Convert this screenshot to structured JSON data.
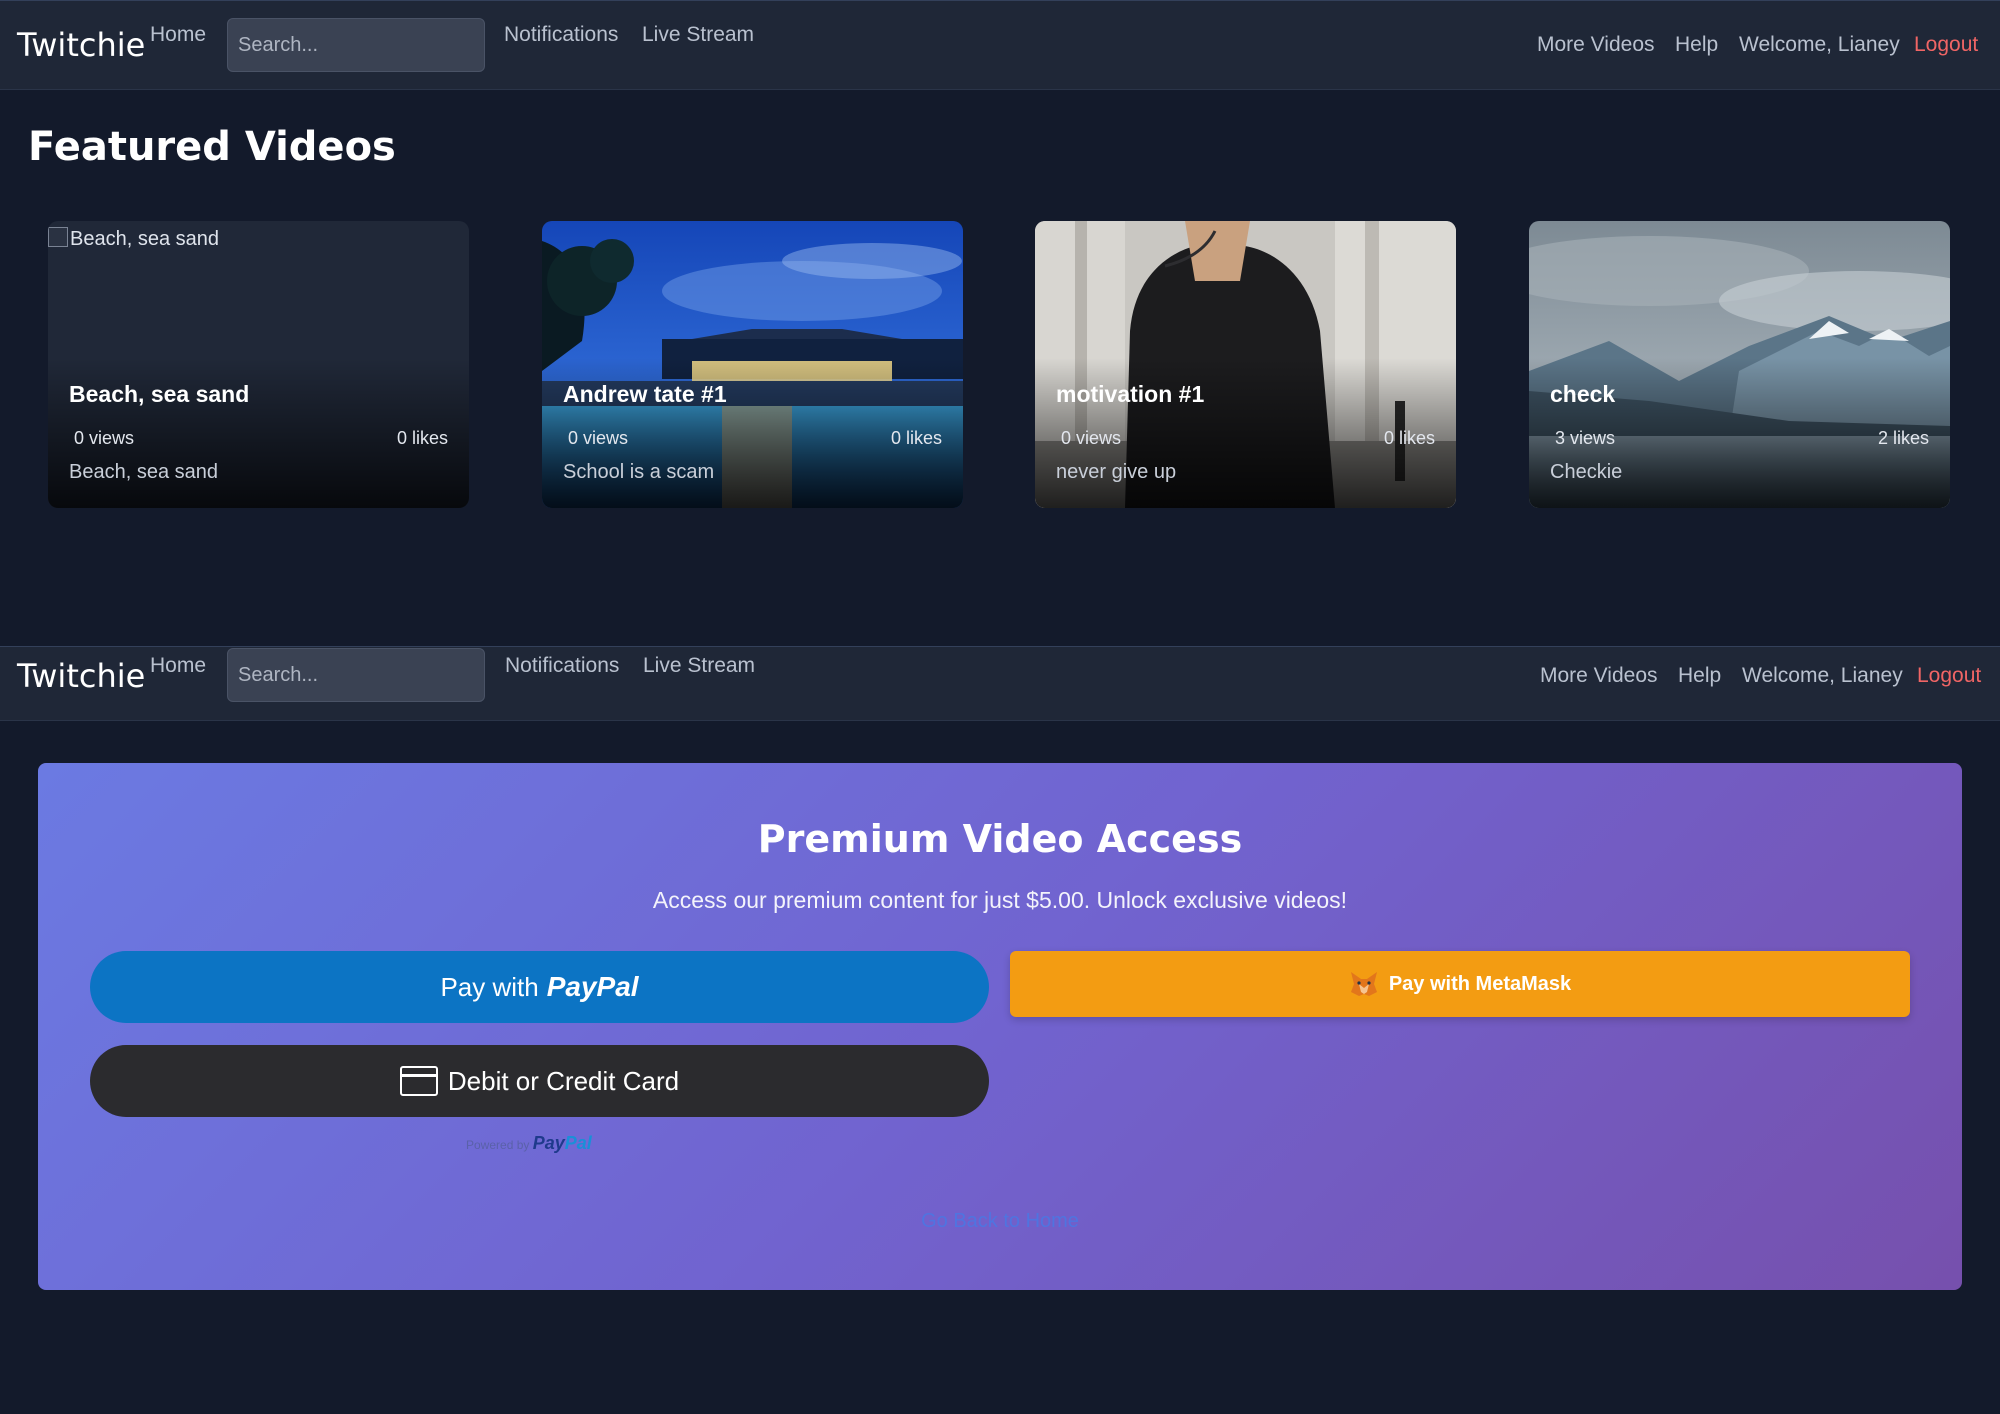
{
  "nav": {
    "brand": "Twitchie",
    "home": "Home",
    "search_placeholder": "Search...",
    "notifications": "Notifications",
    "live_stream": "Live Stream",
    "more_videos": "More Videos",
    "help": "Help",
    "welcome": "Welcome, Lianey",
    "logout": "Logout"
  },
  "featured": {
    "title": "Featured Videos",
    "cards": [
      {
        "alt": "Beach, sea sand",
        "title": "Beach, sea sand",
        "views": "0 views",
        "likes": "0 likes",
        "desc": "Beach, sea sand"
      },
      {
        "title": "Andrew tate #1",
        "views": "0 views",
        "likes": "0 likes",
        "desc": "School is a scam"
      },
      {
        "title": "motivation #1",
        "views": "0 views",
        "likes": "0 likes",
        "desc": "never give up"
      },
      {
        "title": "check",
        "views": "3 views",
        "likes": "2 likes",
        "desc": "Checkie"
      }
    ]
  },
  "premium": {
    "title": "Premium Video Access",
    "subtitle": "Access our premium content for just $5.00. Unlock exclusive videos!",
    "paypal_prefix": "Pay with",
    "paypal_brand": "PayPal",
    "card_label": "Debit or Credit Card",
    "metamask_label": "Pay with MetaMask",
    "powered_by": "Powered by",
    "powered_pay": "Pay",
    "powered_pal": "Pal",
    "back_link": "Go Back to Home"
  },
  "colors": {
    "background": "#131a2b",
    "navbar": "#1f2737",
    "logout": "#f06565",
    "paypal_blue": "#0c74c4",
    "metamask_orange": "#f39c12",
    "premium_gradient_start": "#6b7ae2",
    "premium_gradient_end": "#7650ad"
  }
}
